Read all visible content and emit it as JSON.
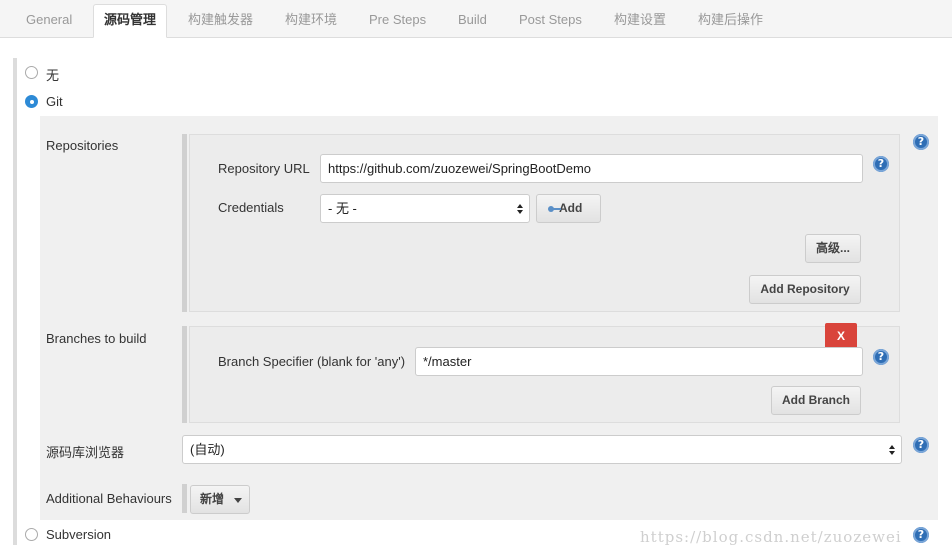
{
  "tabs": [
    {
      "label": "General",
      "active": false
    },
    {
      "label": "源码管理",
      "active": true
    },
    {
      "label": "构建触发器",
      "active": false
    },
    {
      "label": "构建环境",
      "active": false
    },
    {
      "label": "Pre Steps",
      "active": false
    },
    {
      "label": "Build",
      "active": false
    },
    {
      "label": "Post Steps",
      "active": false
    },
    {
      "label": "构建设置",
      "active": false
    },
    {
      "label": "构建后操作",
      "active": false
    }
  ],
  "scm": {
    "options": [
      {
        "label": "无",
        "selected": false
      },
      {
        "label": "Git",
        "selected": true
      },
      {
        "label": "Subversion",
        "selected": false
      }
    ],
    "repositories": {
      "label": "Repositories",
      "url_label": "Repository URL",
      "url_value": "https://github.com/zuozewei/SpringBootDemo",
      "credentials_label": "Credentials",
      "credentials_value": "- 无 -",
      "add_label": "Add",
      "advanced_label": "高级...",
      "add_repository_label": "Add Repository"
    },
    "branches": {
      "label": "Branches to build",
      "delete_label": "X",
      "specifier_label": "Branch Specifier (blank for 'any')",
      "specifier_value": "*/master",
      "add_branch_label": "Add Branch"
    },
    "browser": {
      "label": "源码库浏览器",
      "value": "(自动)"
    },
    "behaviours": {
      "label": "Additional Behaviours",
      "add_label": "新增"
    }
  },
  "help_symbol": "?",
  "watermark": "https://blog.csdn.net/zuozewei",
  "colors": {
    "accent": "#2d8ad6",
    "help": "#2f6eb5",
    "delete": "#d9443b"
  }
}
